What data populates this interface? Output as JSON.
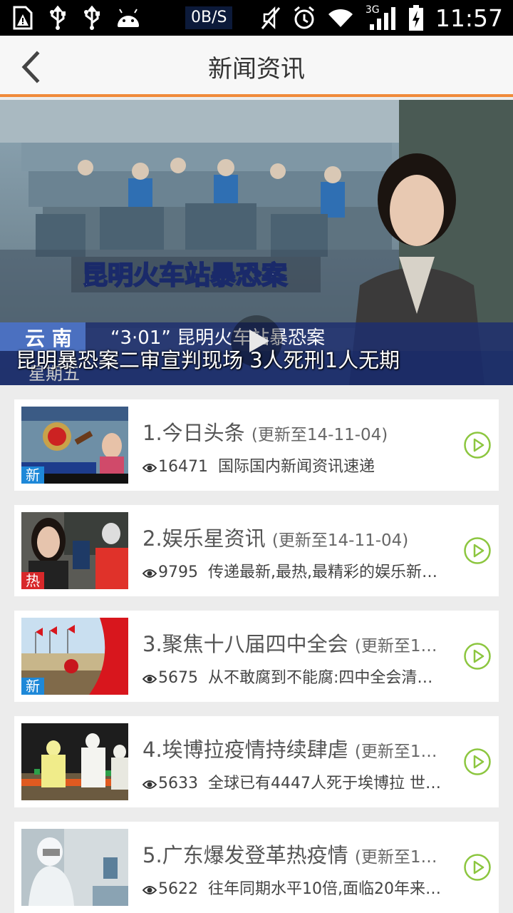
{
  "status_bar": {
    "net_speed": "0B/S",
    "network_type": "3G",
    "time": "11:57",
    "icons": [
      "warning-sim-icon",
      "usb-icon",
      "usb-icon",
      "android-icon",
      "mute-icon",
      "alarm-icon",
      "wifi-icon",
      "signal-icon",
      "battery-charging-icon"
    ]
  },
  "header": {
    "title": "新闻资讯",
    "back_icon": "chevron-left-icon"
  },
  "banner": {
    "caption": "昆明暴恐案二审宣判现场 3人死刑1人无期"
  },
  "news": [
    {
      "index": "1.",
      "title": "今日头条",
      "updated": "(更新至14-11-04)",
      "views": "16471",
      "desc": "国际国内新闻资讯速递",
      "tag": "新",
      "tag_type": "new"
    },
    {
      "index": "2.",
      "title": "娱乐星资讯",
      "updated": "(更新至14-11-04)",
      "views": "9795",
      "desc": "传递最新,最热,最精彩的娱乐新…",
      "tag": "热",
      "tag_type": "hot"
    },
    {
      "index": "3.",
      "title": "聚焦十八届四中全会",
      "updated": "(更新至1…",
      "views": "5675",
      "desc": "从不敢腐到不能腐:四中全会清…",
      "tag": "新",
      "tag_type": "new"
    },
    {
      "index": "4.",
      "title": "埃博拉疫情持续肆虐",
      "updated": "(更新至1…",
      "views": "5633",
      "desc": "全球已有4447人死于埃博拉 世…",
      "tag": "",
      "tag_type": ""
    },
    {
      "index": "5.",
      "title": "广东爆发登革热疫情",
      "updated": "(更新至1…",
      "views": "5622",
      "desc": "往年同期水平10倍,面临20年来…",
      "tag": "",
      "tag_type": ""
    }
  ],
  "colors": {
    "accent": "#f08a3a",
    "play_green": "#8cc63f",
    "tag_new": "#1e88d8",
    "tag_hot": "#d8282a"
  }
}
